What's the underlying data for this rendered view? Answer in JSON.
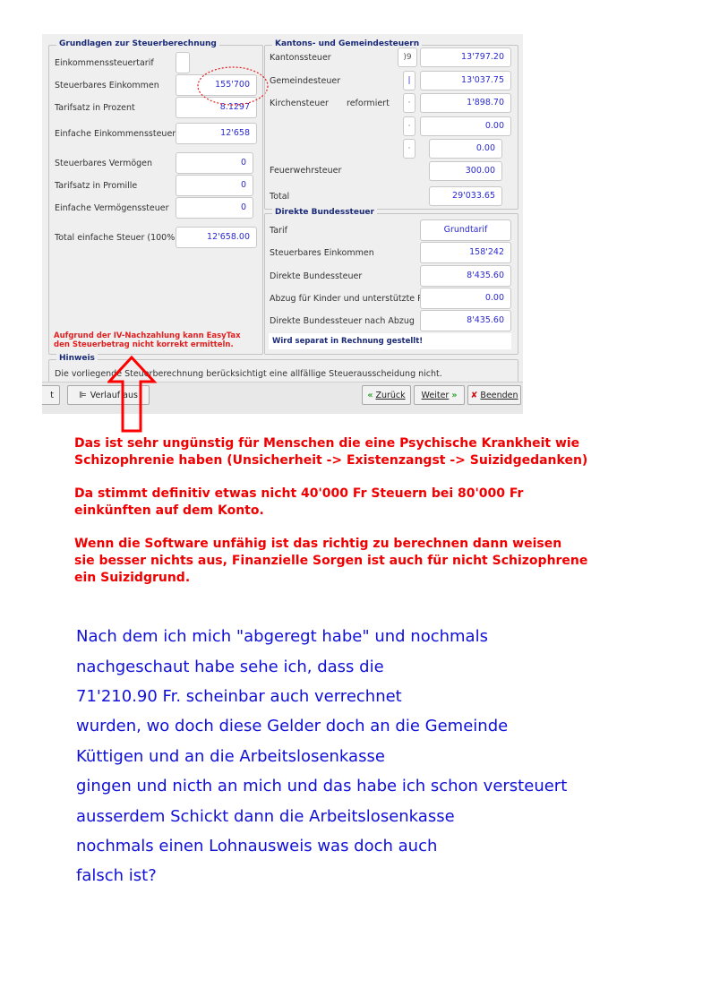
{
  "left_panel": {
    "legend": "Grundlagen zur Steuerberechnung",
    "rows": [
      {
        "label": "Einkommenssteuertarif",
        "value": ""
      },
      {
        "label": "Steuerbares Einkommen",
        "value": "155'700"
      },
      {
        "label": "Tarifsatz in Prozent",
        "value": "8.1297"
      },
      {
        "label": "Einfache Einkommenssteuer",
        "value": "12'658"
      },
      {
        "label": "Steuerbares Vermögen",
        "value": "0"
      },
      {
        "label": "Tarifsatz in Promille",
        "value": "0"
      },
      {
        "label": "Einfache Vermögenssteuer",
        "value": "0"
      },
      {
        "label": "Total einfache Steuer (100%)",
        "value": "12'658.00"
      }
    ],
    "warning_line1": "Aufgrund der IV-Nachzahlung kann EasyTax",
    "warning_line2": "den Steuerbetrag nicht korrekt ermitteln."
  },
  "kanton_panel": {
    "legend": "Kantons- und Gemeindesteuern",
    "rows": [
      {
        "label": "Kantonssteuer",
        "mini": ")9",
        "value": "13'797.20"
      },
      {
        "label": "Gemeindesteuer",
        "mini": "|",
        "value": "13'037.75"
      },
      {
        "label": "Kirchensteuer",
        "mini": "·",
        "value": "1'898.70"
      },
      {
        "label": "",
        "mini": "·",
        "value": "0.00"
      },
      {
        "label": "",
        "mini": "·",
        "value": "0.00"
      },
      {
        "label": "Feuerwehrsteuer",
        "value": "300.00"
      },
      {
        "label": "Total",
        "value": "29'033.65"
      }
    ],
    "kirche_confession": "reformiert"
  },
  "bund_panel": {
    "legend": "Direkte Bundessteuer",
    "rows": [
      {
        "label": "Tarif",
        "value": "Grundtarif"
      },
      {
        "label": "Steuerbares Einkommen",
        "value": "158'242"
      },
      {
        "label": "Direkte Bundessteuer",
        "value": "8'435.60"
      },
      {
        "label": "Abzug für Kinder und unterstützte P...",
        "value": "0.00"
      },
      {
        "label": "Direkte Bundessteuer nach Abzug",
        "value": "8'435.60"
      }
    ],
    "note": "Wird separat in Rechnung gestellt!"
  },
  "hinweis": {
    "legend": "Hinweis",
    "text": "Die vorliegende Steuerberechnung berücksichtigt eine allfällige Steuerausscheidung nicht."
  },
  "buttons": {
    "left_fragment": "t",
    "verlauf": "Verlauf aus",
    "zurueck": "Zurück",
    "weiter": "Weiter",
    "beenden": "Beenden"
  },
  "comments": {
    "red1_line1": "Das ist sehr ungünstig für Menschen die eine Psychische Krankheit wie",
    "red1_line2": "Schizophrenie haben (Unsicherheit -> Existenzangst -> Suizidgedanken)",
    "red2_line1": "Da stimmt definitiv etwas nicht 40'000 Fr Steuern bei 80'000 Fr",
    "red2_line2": "einkünften auf dem Konto.",
    "red3_line1": "Wenn die Software unfähig ist das richtig zu berechnen dann weisen",
    "red3_line2": "sie besser nichts aus, Finanzielle Sorgen ist auch für nicht Schizophrene",
    "red3_line3": "ein Suizidgrund.",
    "blue_lines": [
      "Nach dem ich mich \"abgeregt habe\" und nochmals",
      "nachgeschaut habe sehe ich, dass die",
      "71'210.90 Fr. scheinbar auch verrechnet",
      "wurden, wo doch diese Gelder doch an die Gemeinde",
      "Küttigen und an die Arbeitslosenkasse",
      "gingen und nicth an mich und das habe ich schon versteuert",
      "ausserdem Schickt dann die Arbeitslosenkasse",
      "nochmals einen Lohnausweis was doch auch",
      "falsch ist?"
    ]
  },
  "colors": {
    "value_blue": "#2a2ad0",
    "legend_navy": "#1a2a78",
    "annotation_red": "#f00000",
    "note_blue": "#1010d8"
  }
}
